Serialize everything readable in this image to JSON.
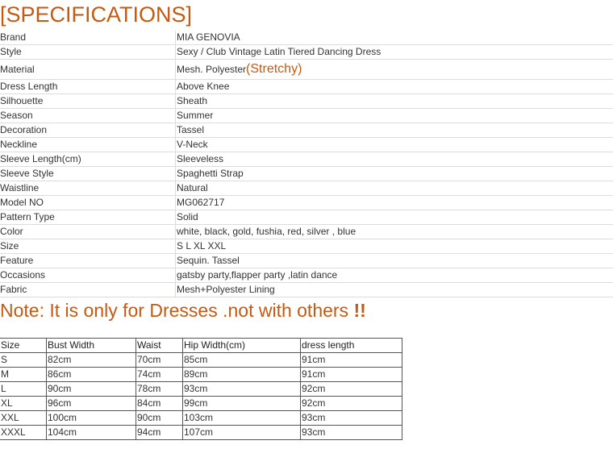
{
  "title": "[SPECIFICATIONS]",
  "specs": [
    {
      "k": "Brand",
      "v": "MIA GENOVIA"
    },
    {
      "k": "Style",
      "v": "Sexy / Club Vintage Latin Tiered Dancing Dress"
    },
    {
      "k": "Material",
      "v": "Mesh. Polyester",
      "extra": "(Stretchy)"
    },
    {
      "k": "Dress Length",
      "v": "Above Knee"
    },
    {
      "k": "Silhouette",
      "v": "Sheath"
    },
    {
      "k": "Season",
      "v": "Summer"
    },
    {
      "k": "Decoration",
      "v": "Tassel"
    },
    {
      "k": "Neckline",
      "v": "V-Neck"
    },
    {
      "k": "Sleeve Length(cm)",
      "v": "Sleeveless"
    },
    {
      "k": "Sleeve Style",
      "v": "Spaghetti Strap"
    },
    {
      "k": "Waistline",
      "v": "Natural"
    },
    {
      "k": "Model NO",
      "v": "MG062717"
    },
    {
      "k": "Pattern Type",
      "v": "Solid"
    },
    {
      "k": "Color",
      "v": "white, black, gold, fushia, red, silver , blue"
    },
    {
      "k": "Size",
      "v": "S L XL XXL"
    },
    {
      "k": "Feature",
      "v": "Sequin. Tassel"
    },
    {
      "k": "Occasions",
      "v": "gatsby party,flapper party ,latin dance"
    },
    {
      "k": "Fabric",
      "v": "Mesh+Polyester Lining"
    }
  ],
  "note": {
    "text": "Note: It is only for Dresses .not with others ",
    "bang": "!!"
  },
  "size_chart": {
    "headers": [
      "Size",
      "Bust Width",
      "Waist",
      "Hip Width(cm)",
      "dress length"
    ],
    "rows": [
      [
        "S",
        "82cm",
        "70cm",
        "85cm",
        "91cm"
      ],
      [
        "M",
        "86cm",
        "74cm",
        "89cm",
        "91cm"
      ],
      [
        "L",
        "90cm",
        "78cm",
        "93cm",
        "92cm"
      ],
      [
        "XL",
        "96cm",
        "84cm",
        "99cm",
        "92cm"
      ],
      [
        "XXL",
        "100cm",
        "90cm",
        "103cm",
        "93cm"
      ],
      [
        "XXXL",
        "104cm",
        "94cm",
        "107cm",
        "93cm"
      ]
    ]
  },
  "colors": {
    "accent": "#c55a11",
    "text": "#333333",
    "rule": "#dcdcdc",
    "grid": "#555555"
  }
}
